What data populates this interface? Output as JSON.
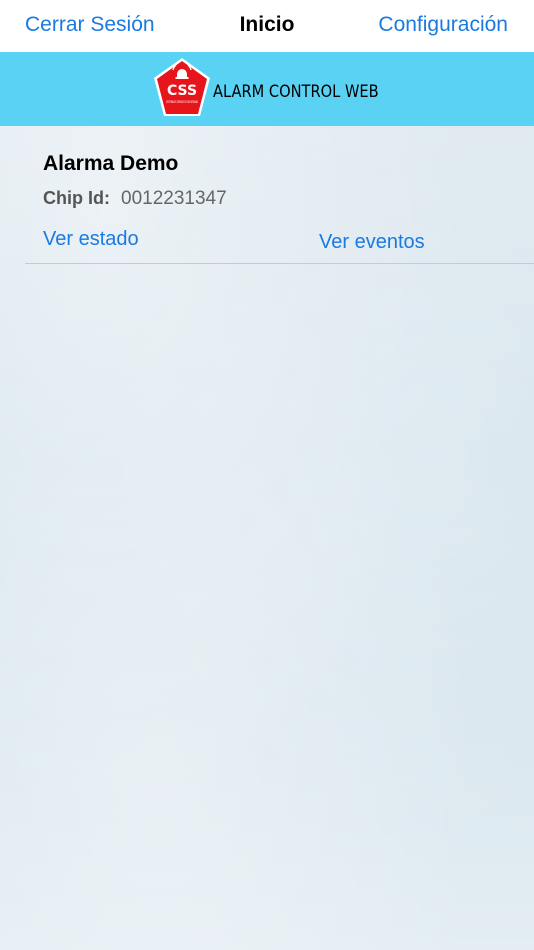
{
  "navbar": {
    "left_label": "Cerrar Sesión",
    "title": "Inicio",
    "right_label": "Configuración"
  },
  "banner": {
    "logo_text": "CSS",
    "logo_subtext": "CENTRALES SERVICIOS SEGURIDAD",
    "title": "ALARM CONTROL WEB",
    "background_color": "#5ad2f4",
    "logo_color": "#e8141c",
    "logo_icon": "alarm-siren-icon"
  },
  "alarms": [
    {
      "name": "Alarma Demo",
      "chip_label": "Chip Id:",
      "chip_value": "0012231347",
      "status_link": "Ver estado",
      "events_link": "Ver eventos"
    }
  ],
  "colors": {
    "link": "#1a7ae0",
    "background": "#dde8ef"
  }
}
